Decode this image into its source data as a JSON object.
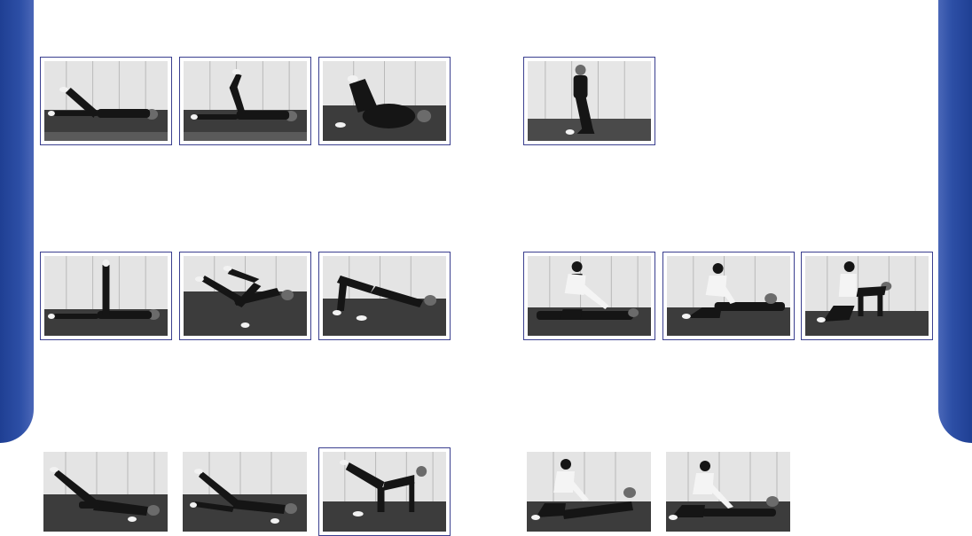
{
  "page": {
    "accent_color": "#2d4fa6",
    "frame_color": "#3a3f8f"
  },
  "photos": [
    {
      "id": "p1",
      "scene": "lying-leg-raise",
      "framed": true
    },
    {
      "id": "p2",
      "scene": "lying-knee-bend",
      "framed": true
    },
    {
      "id": "p3",
      "scene": "lying-knees-to-chest",
      "framed": true
    },
    {
      "id": "p4",
      "scene": "kneeling-upright",
      "framed": true
    },
    {
      "id": "p5",
      "scene": "lying-vertical-leg",
      "framed": true
    },
    {
      "id": "p6",
      "scene": "lying-cycling-legs",
      "framed": true
    },
    {
      "id": "p7",
      "scene": "bridge",
      "framed": true
    },
    {
      "id": "p8",
      "scene": "assisted-prone-stretch",
      "framed": true
    },
    {
      "id": "p9",
      "scene": "assisted-prone-legs",
      "framed": true
    },
    {
      "id": "p10",
      "scene": "assisted-all-fours",
      "framed": true
    },
    {
      "id": "p11",
      "scene": "side-lying-leg-lift",
      "framed": false
    },
    {
      "id": "p12",
      "scene": "side-lying-leg-lift-2",
      "framed": false
    },
    {
      "id": "p13",
      "scene": "all-fours-leg-extension",
      "framed": true
    },
    {
      "id": "p14",
      "scene": "assisted-prone-lift",
      "framed": false
    },
    {
      "id": "p15",
      "scene": "assisted-prone-lift-2",
      "framed": false
    }
  ]
}
